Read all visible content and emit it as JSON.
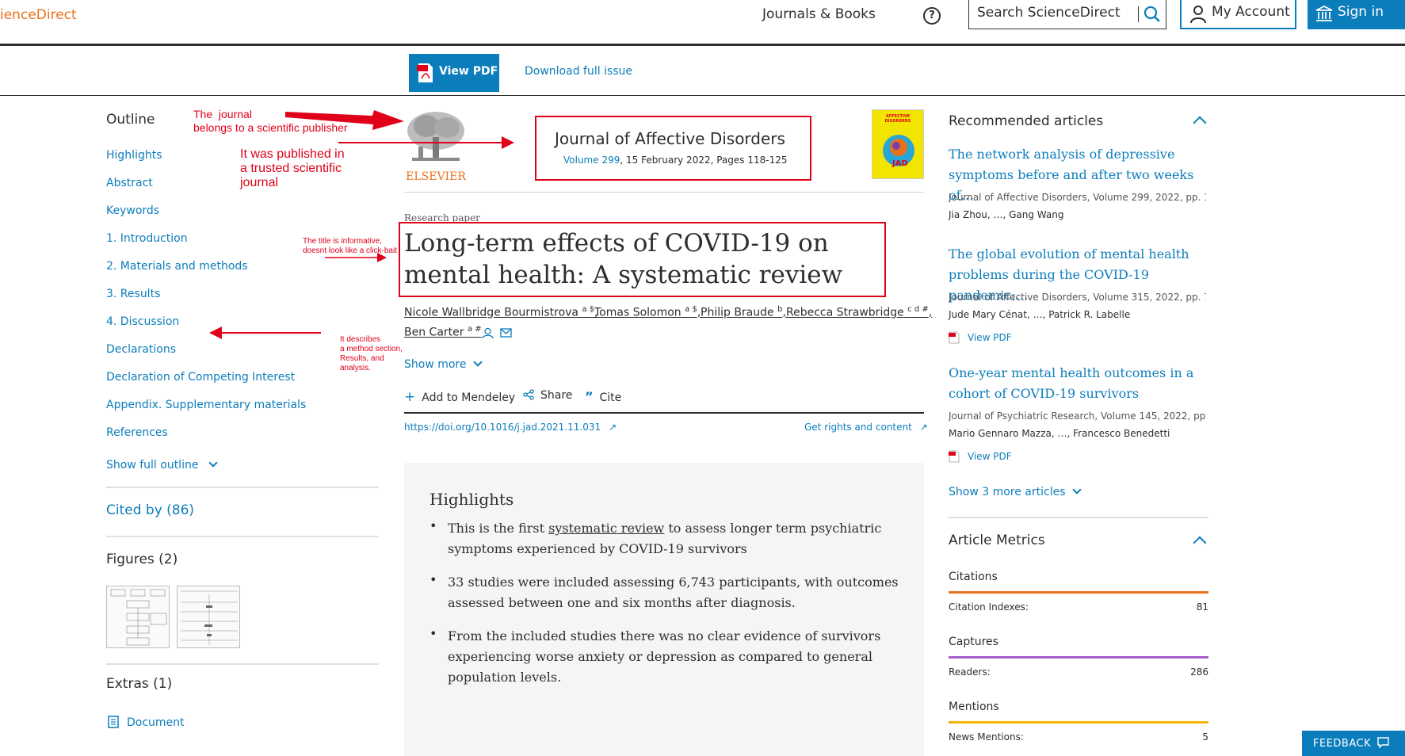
{
  "header": {
    "logo": "ienceDirect",
    "nav_journals": "Journals & Books",
    "help_icon": "question-circle-icon",
    "search_placeholder": "Search ScienceDirect",
    "account": "My Account",
    "signin": "Sign in"
  },
  "toolbar": {
    "view_pdf": "View PDF",
    "download_issue": "Download full issue"
  },
  "outline": {
    "title": "Outline",
    "items": [
      "Highlights",
      "Abstract",
      "Keywords",
      "1. Introduction",
      "2. Materials and methods",
      "3. Results",
      "4. Discussion",
      "Declarations",
      "Declaration of Competing Interest",
      "Appendix. Supplementary materials",
      "References"
    ],
    "show_full": "Show full outline",
    "cited_by": "Cited by (86)",
    "figures": "Figures (2)",
    "extras": "Extras (1)",
    "extras_doc": "Document"
  },
  "article": {
    "publisher": "ELSEVIER",
    "journal": "Journal of Affective Disorders",
    "volume_link": "Volume 299",
    "volume_rest": ", 15 February 2022, Pages 118-125",
    "cover_title": "AFFECTIVE DISORDERS",
    "cover_code": "JAD",
    "type": "Research paper",
    "title": "Long-term effects of COVID-19 on mental health: A systematic review",
    "authors": [
      {
        "name": "Nicole Wallbridge Bourmistrova",
        "sup": "a $"
      },
      {
        "name": "Tomas Solomon",
        "sup": "a $"
      },
      {
        "name": "Philip Braude",
        "sup": "b"
      },
      {
        "name": "Rebecca Strawbridge",
        "sup": "c d #"
      },
      {
        "name": "Ben Carter",
        "sup": "a #"
      }
    ],
    "show_more": "Show more",
    "actions": {
      "mendeley": "Add to Mendeley",
      "share": "Share",
      "cite": "Cite"
    },
    "doi": "https://doi.org/10.1016/j.jad.2021.11.031",
    "rights": "Get rights and content"
  },
  "highlights": {
    "title": "Highlights",
    "items": [
      {
        "pre": "This is the first ",
        "link": "systematic review",
        "post": " to assess longer term psychiatric symptoms experienced by COVID-19 survivors"
      },
      {
        "pre": "33 studies were included assessing 6,743 participants, with outcomes assessed between one and six months after diagnosis.",
        "link": "",
        "post": ""
      },
      {
        "pre": "From the included studies there was no clear evidence of survivors experiencing worse anxiety or depression as compared to general population levels.",
        "link": "",
        "post": ""
      }
    ]
  },
  "recommended": {
    "title": "Recommended articles",
    "items": [
      {
        "title": "The network analysis of depressive symptoms before and after two weeks of…",
        "meta": "Journal of Affective Disorders, Volume 299, 2022, pp. 1…",
        "authors": "Jia Zhou, …, Gang Wang",
        "pdf": ""
      },
      {
        "title": "The global evolution of mental health problems during the COVID-19 pandemic:…",
        "meta": "Journal of Affective Disorders, Volume 315, 2022, pp. 7…",
        "authors": "Jude Mary Cénat, …, Patrick R. Labelle",
        "pdf": "View PDF"
      },
      {
        "title": "One-year mental health outcomes in a cohort of COVID-19 survivors",
        "meta": "Journal of Psychiatric Research, Volume 145, 2022, pp. …",
        "authors": "Mario Gennaro Mazza, …, Francesco Benedetti",
        "pdf": "View PDF"
      }
    ],
    "show_more": "Show 3 more articles"
  },
  "metrics": {
    "title": "Article Metrics",
    "groups": [
      {
        "category": "Citations",
        "label": "Citation Indexes:",
        "value": "81",
        "color": "#e9711c"
      },
      {
        "category": "Captures",
        "label": "Readers:",
        "value": "286",
        "color": "#a35fc7"
      },
      {
        "category": "Mentions",
        "label": "News Mentions:",
        "value": "5",
        "color": "#f0b400"
      }
    ]
  },
  "feedback": "FEEDBACK",
  "annotations": {
    "publisher_note": "The  journal\nbelongs to a scientific publisher",
    "journal_note": "It was published in\na trusted scientific\njournal",
    "title_note": "The title is informative,\ndoesnt look like a click-bait",
    "sections_note": "It describes\na method section,\nResults, and\nanalysis."
  }
}
